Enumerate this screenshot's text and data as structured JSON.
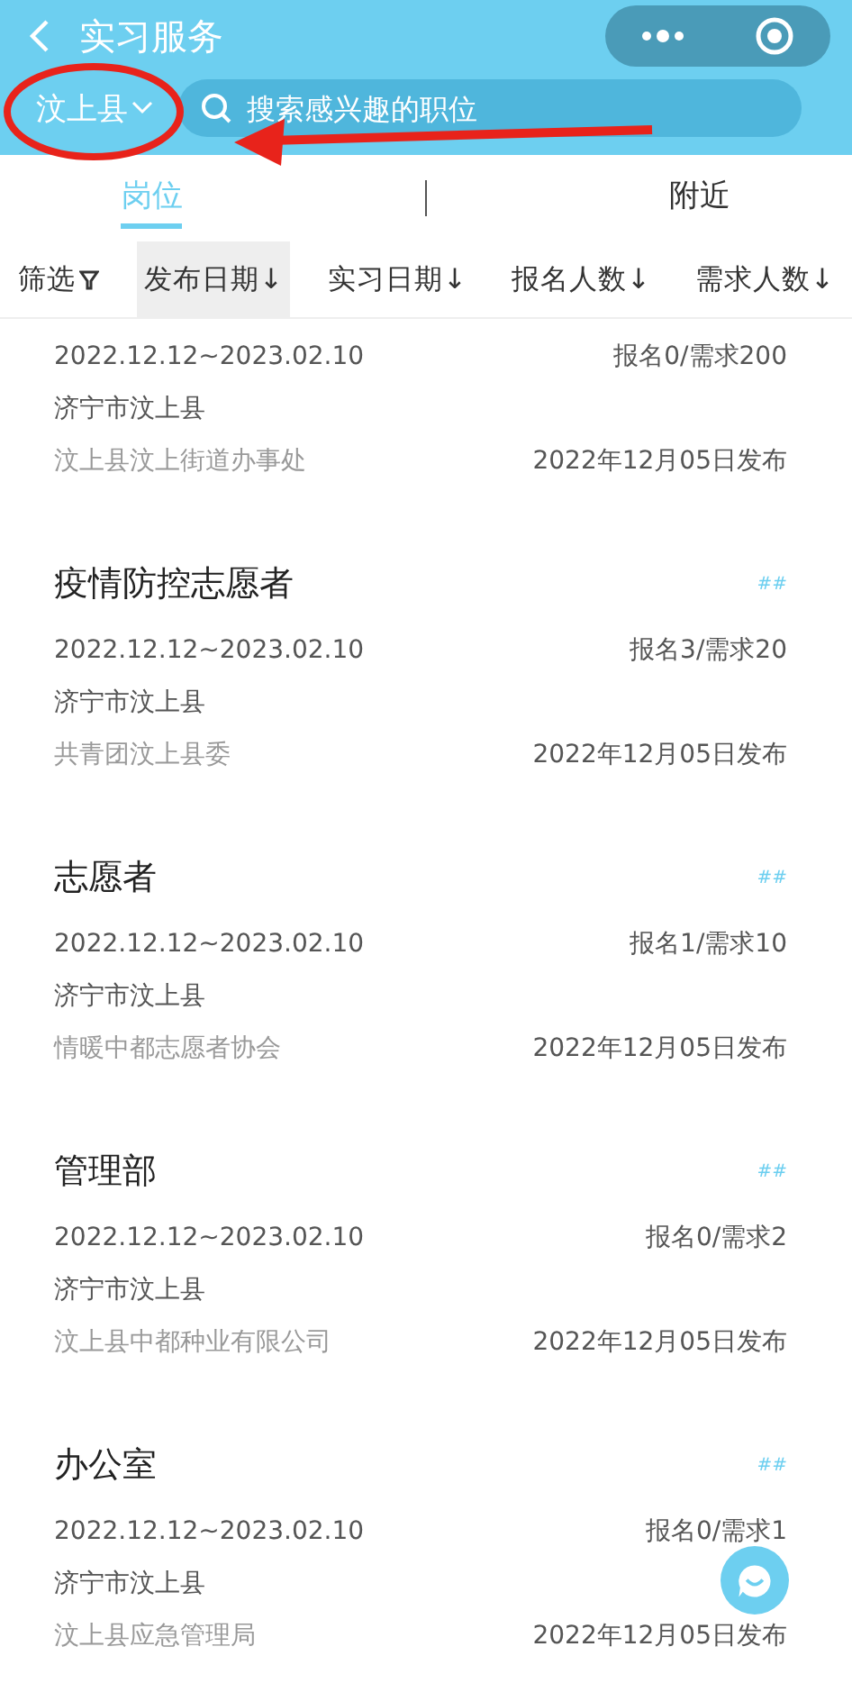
{
  "header": {
    "title": "实习服务",
    "region": "汶上县",
    "search": {
      "placeholder": "搜索感兴趣的职位"
    }
  },
  "tabs": [
    {
      "label": "岗位",
      "selected": true
    },
    {
      "label": "附近",
      "selected": false
    }
  ],
  "sort_bar": [
    {
      "label": "筛选",
      "kind": "filter",
      "selected": false
    },
    {
      "label": "发布日期↓",
      "kind": "sort",
      "selected": true
    },
    {
      "label": "实习日期↓",
      "kind": "sort",
      "selected": false
    },
    {
      "label": "报名人数↓",
      "kind": "sort",
      "selected": false
    },
    {
      "label": "需求人数↓",
      "kind": "sort",
      "selected": false
    }
  ],
  "jobs": [
    {
      "dates": "2022.12.12~2023.02.10",
      "counts": "报名0/需求200",
      "city": "济宁市汶上县",
      "org": "汶上县汶上街道办事处",
      "published": "2022年12月05日发布"
    },
    {
      "title": "疫情防控志愿者",
      "tag": "##",
      "dates": "2022.12.12~2023.02.10",
      "counts": "报名3/需求20",
      "city": "济宁市汶上县",
      "org": "共青团汶上县委",
      "published": "2022年12月05日发布"
    },
    {
      "title": "志愿者",
      "tag": "##",
      "dates": "2022.12.12~2023.02.10",
      "counts": "报名1/需求10",
      "city": "济宁市汶上县",
      "org": "情暖中都志愿者协会",
      "published": "2022年12月05日发布"
    },
    {
      "title": "管理部",
      "tag": "##",
      "dates": "2022.12.12~2023.02.10",
      "counts": "报名0/需求2",
      "city": "济宁市汶上县",
      "org": "汶上县中都种业有限公司",
      "published": "2022年12月05日发布"
    },
    {
      "title": "办公室",
      "tag": "##",
      "dates": "2022.12.12~2023.02.10",
      "counts": "报名0/需求1",
      "city": "济宁市汶上县",
      "org": "汶上县应急管理局",
      "published": "2022年12月05日发布"
    }
  ]
}
